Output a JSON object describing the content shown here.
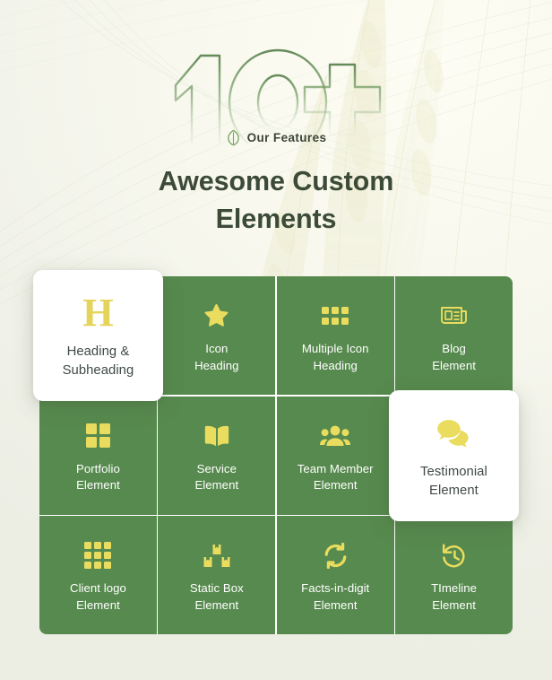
{
  "page": {
    "big_number": "10+",
    "eyebrow_label": "Our Features",
    "eyebrow_icon": "leaf-icon",
    "title_line1": "Awesome Custom",
    "title_line2": "Elements"
  },
  "colors": {
    "card_green": "#578a4e",
    "icon_yellow": "#e9dc5e",
    "heading_dark": "#3c4a38",
    "card_white": "#ffffff",
    "divider": "#ffffff",
    "background": "#f2f3ec",
    "outline_number": "#6d9161"
  },
  "grid": {
    "columns": 4,
    "rows": 3,
    "cards": [
      {
        "icon": "heading-h-icon",
        "label": "Heading &\nSubheading",
        "label_line1": "Heading &",
        "label_line2": "Subheading",
        "state": "active"
      },
      {
        "icon": "star-icon",
        "label": "Icon\nHeading",
        "label_line1": "Icon",
        "label_line2": "Heading",
        "state": "default"
      },
      {
        "icon": "grid-3x2-icon",
        "label": "Multiple Icon\nHeading",
        "label_line1": "Multiple Icon",
        "label_line2": "Heading",
        "state": "default"
      },
      {
        "icon": "newspaper-icon",
        "label": "Blog\nElement",
        "label_line1": "Blog",
        "label_line2": "Element",
        "state": "default"
      },
      {
        "icon": "grid-2x2-icon",
        "label": "Portfolio\nElement",
        "label_line1": "Portfolio",
        "label_line2": "Element",
        "state": "default"
      },
      {
        "icon": "open-book-icon",
        "label": "Service\nElement",
        "label_line1": "Service",
        "label_line2": "Element",
        "state": "default"
      },
      {
        "icon": "people-group-icon",
        "label": "Team Member\nElement",
        "label_line1": "Team Member",
        "label_line2": "Element",
        "state": "default"
      },
      {
        "icon": "speech-bubbles-icon",
        "label": "Testimonial\nElement",
        "label_line1": "Testimonial",
        "label_line2": "Element",
        "state": "active"
      },
      {
        "icon": "grid-3x3-icon",
        "label": "Client logo\nElement",
        "label_line1": "Client logo",
        "label_line2": "Element",
        "state": "default"
      },
      {
        "icon": "stacked-boxes-icon",
        "label": "Static Box\nElement",
        "label_line1": "Static Box",
        "label_line2": "Element",
        "state": "default"
      },
      {
        "icon": "refresh-sync-icon",
        "label": "Facts-in-digit\nElement",
        "label_line1": "Facts-in-digit",
        "label_line2": "Element",
        "state": "default"
      },
      {
        "icon": "clock-history-icon",
        "label": "TImeline\nElement",
        "label_line1": "TImeline",
        "label_line2": "Element",
        "state": "default"
      }
    ]
  }
}
